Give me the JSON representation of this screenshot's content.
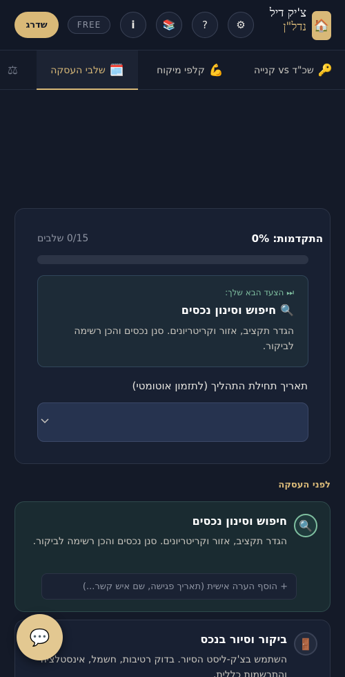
{
  "header": {
    "brand_line1": "צ'יק דיל",
    "brand_line2": "נדל\"ן",
    "logo_icon": "🏠",
    "settings_icon": "⚙",
    "help_icon": "?",
    "library_icon": "📚",
    "info_icon": "i",
    "plan_badge": "FREE",
    "upgrade_label": "שדרג",
    "accent_color": "#d9b978"
  },
  "tabs": [
    {
      "label": "שכ\"ד vs קנייה",
      "icon": "🔑"
    },
    {
      "label": "קלפי מיקוח",
      "icon": "💪"
    },
    {
      "label": "שלבי העסקה",
      "icon": "🗓️",
      "active": true
    },
    {
      "label": "",
      "icon": "⚖"
    }
  ],
  "progress": {
    "label": "התקדמות: 0%",
    "count": "0/15 שלבים",
    "percent": 0
  },
  "next_step": {
    "hint": "⏭ הצעד הבא שלך:",
    "icon": "🔍",
    "title": "חיפוש וסינון נכסים",
    "description": "הגדר תקציב, אזור וקריטריונים. סנן נכסים והכן רשימה לביקור."
  },
  "date_field": {
    "label": "תאריך תחילת התהליך (לתזמון אוטומטי)",
    "chevron_icon": "⌄"
  },
  "section_title": "לפני העסקה",
  "steps": [
    {
      "icon": "🔍",
      "title": "חיפוש וסינון נכסים",
      "description": "הגדר תקציב, אזור וקריטריונים. סנן נכסים והכן רשימה לביקור.",
      "note_placeholder": "+ הוסף הערה אישית (תאריך פגישה, שם איש קשר...)"
    },
    {
      "icon": "🚪",
      "title": "ביקור וסיור בנכס",
      "description": "השתמש בצ'ק-ליסט הסיור. בדוק רטיבות, חשמל, אינסטלציה והתרשמות כללית."
    }
  ],
  "chat_icon": "💬"
}
